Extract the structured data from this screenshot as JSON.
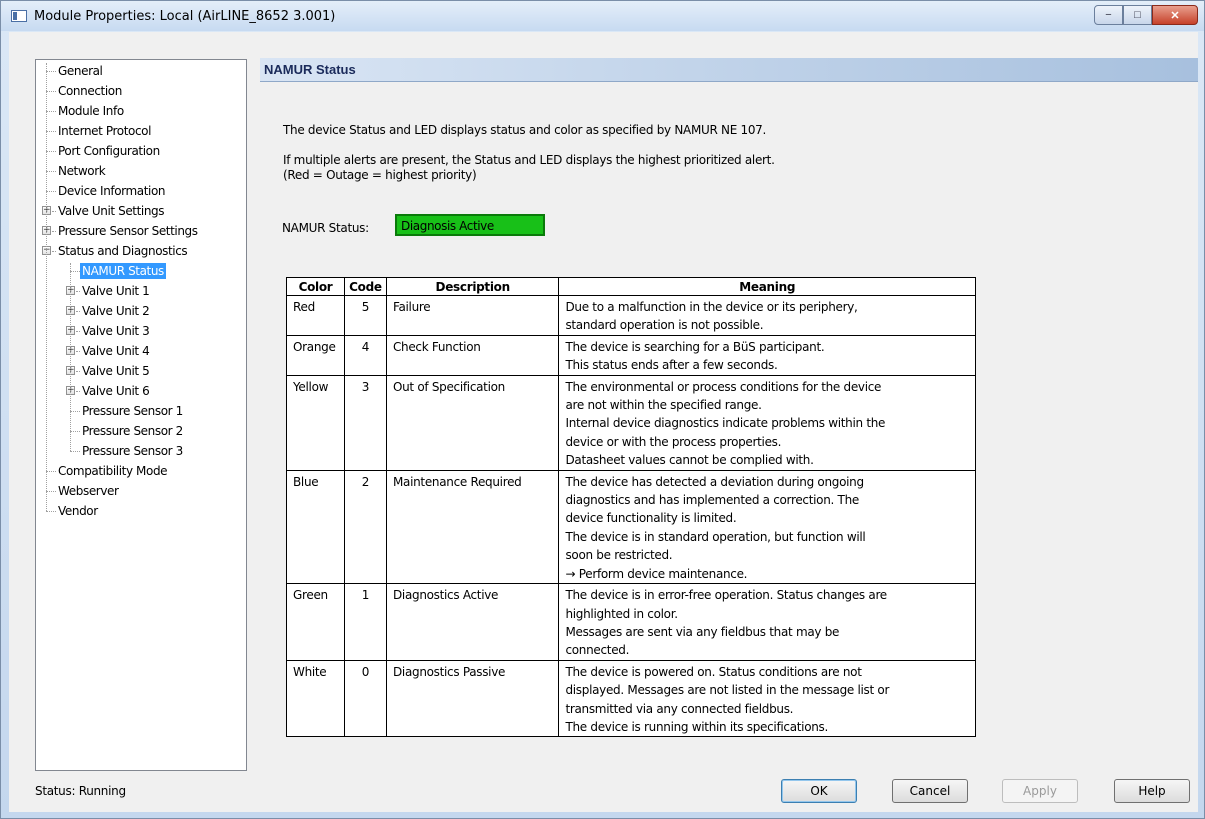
{
  "window": {
    "title": "Module Properties: Local (AirLINE_8652 3.001)",
    "minimize_glyph": "−",
    "maximize_glyph": "□",
    "close_glyph": "✕"
  },
  "tree": {
    "items": [
      {
        "label": "General",
        "level": 0,
        "expander": false
      },
      {
        "label": "Connection",
        "level": 0,
        "expander": false
      },
      {
        "label": "Module Info",
        "level": 0,
        "expander": false
      },
      {
        "label": "Internet Protocol",
        "level": 0,
        "expander": false
      },
      {
        "label": "Port Configuration",
        "level": 0,
        "expander": false
      },
      {
        "label": "Network",
        "level": 0,
        "expander": false
      },
      {
        "label": "Device Information",
        "level": 0,
        "expander": false
      },
      {
        "label": "Valve Unit Settings",
        "level": 0,
        "expander": "+"
      },
      {
        "label": "Pressure Sensor Settings",
        "level": 0,
        "expander": "+"
      },
      {
        "label": "Status and Diagnostics",
        "level": 0,
        "expander": "-"
      },
      {
        "label": "NAMUR Status",
        "level": 1,
        "expander": false,
        "selected": true
      },
      {
        "label": "Valve Unit 1",
        "level": 1,
        "expander": "+"
      },
      {
        "label": "Valve Unit 2",
        "level": 1,
        "expander": "+"
      },
      {
        "label": "Valve Unit 3",
        "level": 1,
        "expander": "+"
      },
      {
        "label": "Valve Unit 4",
        "level": 1,
        "expander": "+"
      },
      {
        "label": "Valve Unit 5",
        "level": 1,
        "expander": "+"
      },
      {
        "label": "Valve Unit 6",
        "level": 1,
        "expander": "+"
      },
      {
        "label": "Pressure Sensor 1",
        "level": 1,
        "expander": false
      },
      {
        "label": "Pressure Sensor 2",
        "level": 1,
        "expander": false
      },
      {
        "label": "Pressure Sensor 3",
        "level": 1,
        "expander": false
      },
      {
        "label": "Compatibility Mode",
        "level": 0,
        "expander": false
      },
      {
        "label": "Webserver",
        "level": 0,
        "expander": false
      },
      {
        "label": "Vendor",
        "level": 0,
        "expander": false
      }
    ]
  },
  "pane": {
    "header": "NAMUR Status",
    "intro": "The device Status and LED displays status and color as specified by NAMUR NE 107.",
    "multi_alert_line1": "If multiple alerts are present, the Status and LED displays the highest prioritized alert.",
    "multi_alert_line2": "(Red = Outage = highest priority)",
    "namur_label": "NAMUR Status:",
    "namur_value": "Diagnosis Active",
    "namur_color": "#18c018"
  },
  "table": {
    "headers": [
      "Color",
      "Code",
      "Description",
      "Meaning"
    ],
    "rows": [
      {
        "color": "Red",
        "code": "5",
        "description": "Failure",
        "meaning": [
          "Due to a malfunction in the device or its periphery,",
          "standard operation is not possible."
        ]
      },
      {
        "color": "Orange",
        "code": "4",
        "description": "Check Function",
        "meaning": [
          "The device is searching for a BüS participant.",
          "This status ends after a few seconds."
        ]
      },
      {
        "color": "Yellow",
        "code": "3",
        "description": "Out of Specification",
        "meaning": [
          "The environmental or process conditions for the device",
          "are not within the specified range.",
          "Internal device diagnostics indicate problems within the",
          "device or with the process properties.",
          "Datasheet values cannot be complied with."
        ]
      },
      {
        "color": "Blue",
        "code": "2",
        "description": "Maintenance Required",
        "meaning": [
          "The device has detected a deviation during ongoing",
          "diagnostics and has implemented a correction.  The",
          "device functionality is limited.",
          "The device is in standard operation, but function will",
          "soon be restricted.",
          "→ Perform device maintenance."
        ]
      },
      {
        "color": "Green",
        "code": "1",
        "description": "Diagnostics Active",
        "meaning": [
          "The device is in error-free operation.  Status changes are",
          "highlighted in color.",
          "Messages are sent via any fieldbus that may be",
          "connected."
        ]
      },
      {
        "color": "White",
        "code": "0",
        "description": "Diagnostics Passive",
        "meaning": [
          "The device is powered on.  Status conditions are not",
          "displayed.  Messages are not listed in the message list or",
          "transmitted via any connected fieldbus.",
          "The device is running within its specifications."
        ]
      }
    ]
  },
  "footer": {
    "status": "Status:  Running",
    "ok": "OK",
    "cancel": "Cancel",
    "apply": "Apply",
    "help": "Help"
  }
}
